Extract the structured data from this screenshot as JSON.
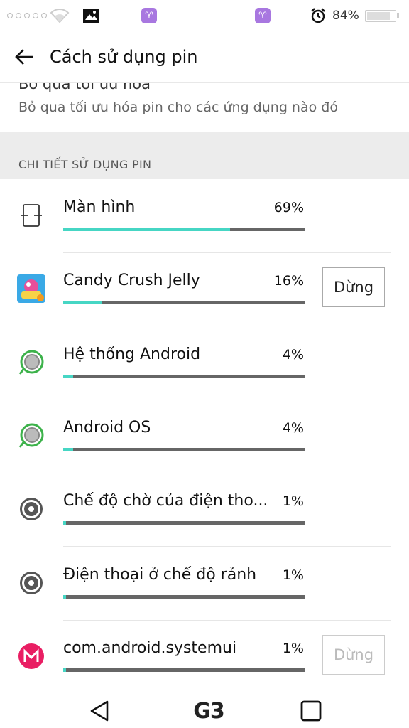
{
  "status_bar": {
    "battery_percent": "84%",
    "battery_level": 0.84,
    "icons": [
      "signal-dots-icon",
      "wifi-icon",
      "gallery-icon",
      "astrology-app-icon",
      "astrology-app-icon",
      "alarm-icon",
      "battery-icon"
    ]
  },
  "app_bar": {
    "title": "Cách sử dụng pin",
    "back_icon": "arrow-left-icon"
  },
  "setting": {
    "title": "Bỏ qua tối ưu hóa",
    "subtitle": "Bỏ qua tối ưu hóa pin cho các ứng dụng nào đó"
  },
  "section": {
    "label": "CHI TIẾT SỬ DỤNG PIN"
  },
  "accent_color": "#46d6c4",
  "rows": [
    {
      "label": "Màn hình",
      "percent": "69%",
      "value": 0.69,
      "icon": "screen-icon",
      "button": null
    },
    {
      "label": "Candy Crush Jelly",
      "percent": "16%",
      "value": 0.16,
      "icon": "candy-crush-jelly-icon",
      "button": "Dừng",
      "button_enabled": true
    },
    {
      "label": "Hệ thống Android",
      "percent": "4%",
      "value": 0.04,
      "icon": "android-system-icon",
      "button": null
    },
    {
      "label": "Android OS",
      "percent": "4%",
      "value": 0.04,
      "icon": "android-os-icon",
      "button": null
    },
    {
      "label": "Chế độ chờ của điện tho...",
      "percent": "1%",
      "value": 0.01,
      "icon": "gear-icon",
      "button": null
    },
    {
      "label": "Điện thoại ở chế độ rảnh",
      "percent": "1%",
      "value": 0.01,
      "icon": "gear-icon",
      "button": null
    },
    {
      "label": "com.android.systemui",
      "percent": "1%",
      "value": 0.01,
      "icon": "systemui-icon",
      "button": "Dừng",
      "button_enabled": false
    }
  ],
  "nav_bar": {
    "back": "back-triangle-icon",
    "home": "G3",
    "recents": "recents-square-icon"
  }
}
